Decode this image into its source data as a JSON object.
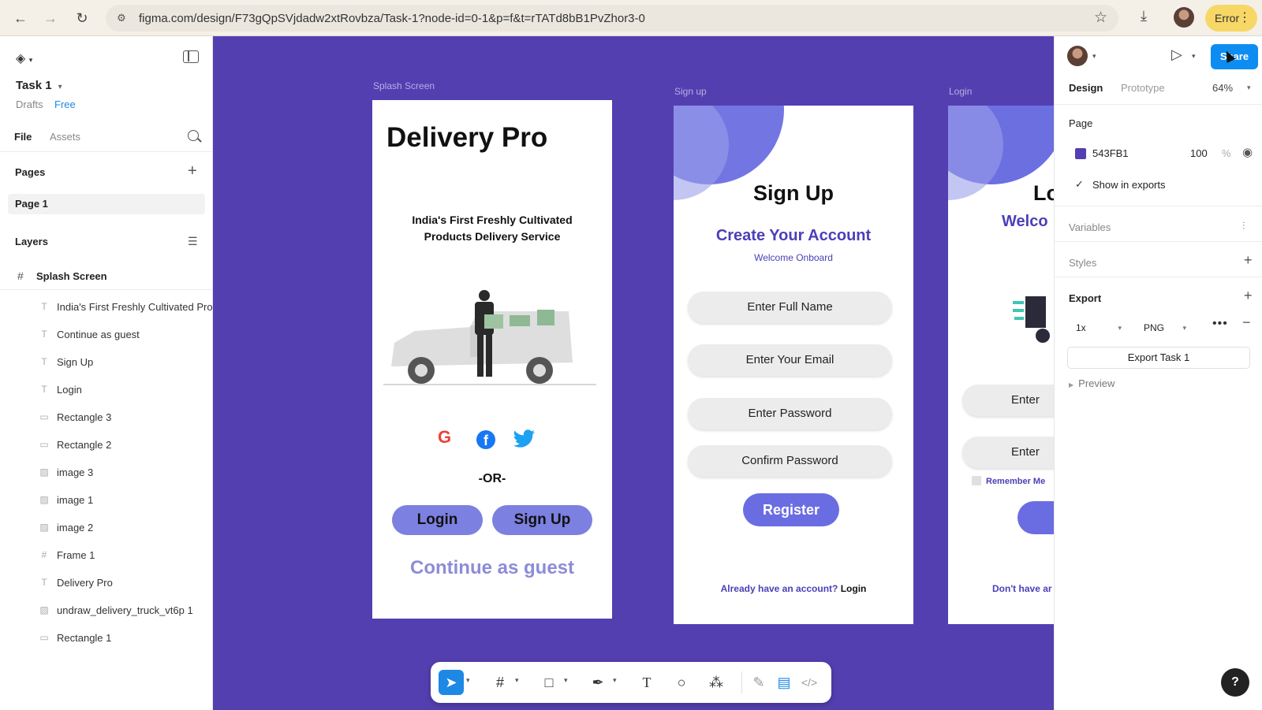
{
  "browser": {
    "url": "figma.com/design/F73gQpSVjdadw2xtRovbza/Task-1?node-id=0-1&p=f&t=rTATd8bB1PvZhor3-0",
    "error_label": "Error"
  },
  "left": {
    "file_title": "Task 1",
    "drafts": "Drafts",
    "plan": "Free",
    "tab_file": "File",
    "tab_assets": "Assets",
    "pages_heading": "Pages",
    "pages": [
      "Page 1"
    ],
    "layers_heading": "Layers",
    "frame_layer": "Splash Screen",
    "layers": [
      {
        "type": "text",
        "icon": "T",
        "label": "India's First Freshly Cultivated Products Delivery Service"
      },
      {
        "type": "text",
        "icon": "T",
        "label": "Continue as guest"
      },
      {
        "type": "text",
        "icon": "T",
        "label": "Sign Up"
      },
      {
        "type": "text",
        "icon": "T",
        "label": "Login"
      },
      {
        "type": "rect",
        "icon": "▭",
        "label": "Rectangle 3"
      },
      {
        "type": "rect",
        "icon": "▭",
        "label": "Rectangle 2"
      },
      {
        "type": "image",
        "icon": "▨",
        "label": "image 3"
      },
      {
        "type": "image",
        "icon": "▨",
        "label": "image 1"
      },
      {
        "type": "image",
        "icon": "▨",
        "label": "image 2"
      },
      {
        "type": "frame",
        "icon": "#",
        "label": "Frame 1"
      },
      {
        "type": "text",
        "icon": "T",
        "label": "Delivery Pro"
      },
      {
        "type": "image",
        "icon": "▨",
        "label": "undraw_delivery_truck_vt6p 1"
      },
      {
        "type": "rect",
        "icon": "▭",
        "label": "Rectangle 1"
      }
    ]
  },
  "canvas": {
    "background": "#543FB1",
    "splash": {
      "frame_label": "Splash Screen",
      "title": "Delivery Pro",
      "tagline_1": "India's First Freshly Cultivated",
      "tagline_2": "Products Delivery Service",
      "social": [
        "G",
        "f",
        "twitter"
      ],
      "or": "-OR-",
      "login": "Login",
      "signup": "Sign Up",
      "guest": "Continue as guest"
    },
    "signup": {
      "frame_label": "Sign up",
      "title": "Sign Up",
      "subtitle": "Create Your Account",
      "welcome": "Welcome Onboard",
      "fields": [
        "Enter Full Name",
        "Enter Your Email",
        "Enter Password",
        "Confirm Password"
      ],
      "register": "Register",
      "footer_text": "Already have an account?",
      "footer_link": "Login"
    },
    "login": {
      "frame_label": "Login",
      "title": "Lo",
      "welcome": "Welco",
      "fields": [
        "Enter",
        "Enter"
      ],
      "remember": "Remember Me",
      "footer": "Don't have ar"
    }
  },
  "toolbar": {
    "tools": [
      "move-icon",
      "frame-icon",
      "rectangle-icon",
      "pen-icon",
      "text-icon",
      "comment-icon",
      "actions-icon",
      "draw-icon",
      "dev-mode-icon",
      "code-icon"
    ]
  },
  "right": {
    "share": "Share",
    "tab_design": "Design",
    "tab_prototype": "Prototype",
    "zoom": "64%",
    "page_heading": "Page",
    "page_color": "543FB1",
    "page_opacity": "100",
    "percent": "%",
    "show_in_exports": "Show in exports",
    "variables": "Variables",
    "styles": "Styles",
    "export_heading": "Export",
    "export_scale": "1x",
    "export_format": "PNG",
    "export_button": "Export Task 1",
    "preview": "Preview",
    "swatch_color": "#543FB1"
  },
  "help": "?"
}
